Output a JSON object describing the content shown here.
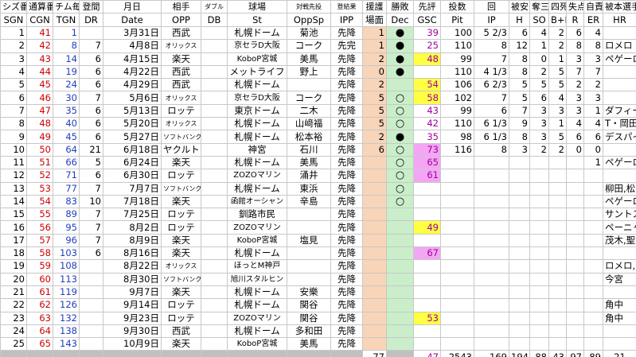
{
  "headers_top": [
    "シズ番",
    "通算番",
    "チム毎",
    "登間",
    "月日",
    "相手",
    "ダブル",
    "球場",
    "対戦先投",
    "登結果",
    "援護",
    "勝敗",
    "先評",
    "投数",
    "回",
    "被安",
    "奪三",
    "四死",
    "失点",
    "自責",
    "被本選手"
  ],
  "headers_bottom": [
    "SGN",
    "CGN",
    "TGN",
    "DR",
    "Date",
    "OPP",
    "DB",
    "St",
    "OppSp",
    "IPP",
    "場面",
    "Dec",
    "GSC",
    "Pit",
    "IP",
    "H",
    "SO",
    "B+H",
    "R",
    "ER",
    "HR"
  ],
  "rows": [
    {
      "sgn": "1",
      "cgn": "41",
      "tgn": "1",
      "dr": "",
      "date": "3月31日",
      "opp": "西武",
      "db": "",
      "st": "札幌ドーム",
      "oppsp": "菊池",
      "ipp": "先降",
      "sup": "1",
      "dec": "●",
      "gsc": "39",
      "pit": "100",
      "ip": "5 2/3",
      "h": "6",
      "so": "4",
      "bh": "2",
      "r": "6",
      "er": "4",
      "hr": ""
    },
    {
      "sgn": "2",
      "cgn": "42",
      "tgn": "8",
      "dr": "7",
      "date": "4月8日",
      "opp": "オリックス",
      "db": "",
      "st": "京セラD大阪",
      "oppsp": "コーク",
      "ipp": "先完",
      "sup": "1",
      "dec": "●",
      "gsc": "25",
      "pit": "110",
      "ip": "8",
      "h": "12",
      "so": "1",
      "bh": "2",
      "r": "8",
      "er": "8",
      "hr": "ロメロ"
    },
    {
      "sgn": "3",
      "cgn": "43",
      "tgn": "14",
      "dr": "6",
      "date": "4月15日",
      "opp": "楽天",
      "db": "",
      "st": "KoboP宮城",
      "oppsp": "美馬",
      "ipp": "先降",
      "sup": "2",
      "dec": "●",
      "gsc": "48",
      "pit": "99",
      "ip": "7",
      "h": "8",
      "so": "0",
      "bh": "1",
      "r": "3",
      "er": "3",
      "hr": "ペゲーロ"
    },
    {
      "sgn": "4",
      "cgn": "44",
      "tgn": "19",
      "dr": "6",
      "date": "4月22日",
      "opp": "西武",
      "db": "",
      "st": "メットライフ",
      "oppsp": "野上",
      "ipp": "先降",
      "sup": "0",
      "dec": "●",
      "gsc": "",
      "pit": "110",
      "ip": "4 1/3",
      "h": "8",
      "so": "2",
      "bh": "5",
      "r": "7",
      "er": "7",
      "hr": ""
    },
    {
      "sgn": "5",
      "cgn": "45",
      "tgn": "24",
      "dr": "6",
      "date": "4月29日",
      "opp": "西武",
      "db": "",
      "st": "札幌ドーム",
      "oppsp": "",
      "ipp": "先降",
      "sup": "2",
      "dec": "",
      "gsc": "54",
      "pit": "106",
      "ip": "6 2/3",
      "h": "5",
      "so": "5",
      "bh": "5",
      "r": "2",
      "er": "2",
      "hr": ""
    },
    {
      "sgn": "6",
      "cgn": "46",
      "tgn": "30",
      "dr": "7",
      "date": "5月6日",
      "opp": "オリックス",
      "db": "",
      "st": "京セラD大阪",
      "oppsp": "コーク",
      "ipp": "先降",
      "sup": "5",
      "dec": "○",
      "gsc": "58",
      "pit": "102",
      "ip": "7",
      "h": "5",
      "so": "6",
      "bh": "4",
      "r": "3",
      "er": "3",
      "hr": ""
    },
    {
      "sgn": "7",
      "cgn": "47",
      "tgn": "35",
      "dr": "6",
      "date": "5月13日",
      "opp": "ロッテ",
      "db": "",
      "st": "東京ドーム",
      "oppsp": "二木",
      "ipp": "先降",
      "sup": "5",
      "dec": "○",
      "gsc": "43",
      "pit": "99",
      "ip": "6",
      "h": "7",
      "so": "3",
      "bh": "3",
      "r": "3",
      "er": "1",
      "hr": "ダフィー,柴田"
    },
    {
      "sgn": "8",
      "cgn": "48",
      "tgn": "40",
      "dr": "6",
      "date": "5月20日",
      "opp": "オリックス",
      "db": "",
      "st": "札幌ドーム",
      "oppsp": "山﨑福",
      "ipp": "先降",
      "sup": "5",
      "dec": "○",
      "gsc": "42",
      "pit": "110",
      "ip": "6 1/3",
      "h": "9",
      "so": "3",
      "bh": "1",
      "r": "4",
      "er": "4",
      "hr": "T・岡田"
    },
    {
      "sgn": "9",
      "cgn": "49",
      "tgn": "45",
      "dr": "6",
      "date": "5月27日",
      "opp": "ソフトバンク",
      "db": "",
      "st": "札幌ドーム",
      "oppsp": "松本裕",
      "ipp": "先降",
      "sup": "2",
      "dec": "●",
      "gsc": "35",
      "pit": "98",
      "ip": "6 1/3",
      "h": "8",
      "so": "3",
      "bh": "5",
      "r": "6",
      "er": "6",
      "hr": "デスパイネ,松田"
    },
    {
      "sgn": "10",
      "cgn": "50",
      "tgn": "64",
      "dr": "21",
      "date": "6月18日",
      "opp": "ヤクルト",
      "db": "",
      "st": "神宮",
      "oppsp": "石川",
      "ipp": "先降",
      "sup": "6",
      "dec": "○",
      "gsc": "73",
      "pit": "116",
      "ip": "8",
      "h": "3",
      "so": "2",
      "bh": "2",
      "r": "0",
      "er": "0",
      "hr": ""
    },
    {
      "sgn": "11",
      "cgn": "51",
      "tgn": "66",
      "dr": "5",
      "date": "6月24日",
      "opp": "楽天",
      "db": "",
      "st": "札幌ドーム",
      "oppsp": "美馬",
      "ipp": "先降",
      "sup": "",
      "dec": "○",
      "gsc": "65",
      "pit": "",
      "ip": "",
      "h": "",
      "so": "",
      "bh": "",
      "r": "",
      "er": "1",
      "hr": "ペゲーロ"
    },
    {
      "sgn": "12",
      "cgn": "52",
      "tgn": "71",
      "dr": "6",
      "date": "6月30日",
      "opp": "ロッテ",
      "db": "",
      "st": "ZOZOマリン",
      "oppsp": "涌井",
      "ipp": "先降",
      "sup": "",
      "dec": "○",
      "gsc": "61",
      "pit": "",
      "ip": "",
      "h": "",
      "so": "",
      "bh": "",
      "r": "",
      "er": "",
      "hr": ""
    },
    {
      "sgn": "13",
      "cgn": "53",
      "tgn": "77",
      "dr": "7",
      "date": "7月7日",
      "opp": "ソフトバンク",
      "db": "",
      "st": "札幌ドーム",
      "oppsp": "東浜",
      "ipp": "先降",
      "sup": "",
      "dec": "○",
      "gsc": "",
      "pit": "",
      "ip": "",
      "h": "",
      "so": "",
      "bh": "",
      "r": "",
      "er": "",
      "hr": "柳田,松田"
    },
    {
      "sgn": "14",
      "cgn": "54",
      "tgn": "83",
      "dr": "10",
      "date": "7月18日",
      "opp": "楽天",
      "db": "",
      "st": "函館オーシャン",
      "oppsp": "辛島",
      "ipp": "先降",
      "sup": "",
      "dec": "○",
      "gsc": "",
      "pit": "",
      "ip": "",
      "h": "",
      "so": "",
      "bh": "",
      "r": "",
      "er": "",
      "hr": "ペゲーロ"
    },
    {
      "sgn": "15",
      "cgn": "55",
      "tgn": "89",
      "dr": "7",
      "date": "7月25日",
      "opp": "ロッテ",
      "db": "",
      "st": "釧路市民",
      "oppsp": "",
      "ipp": "先降",
      "sup": "",
      "dec": "",
      "gsc": "",
      "pit": "",
      "ip": "",
      "h": "",
      "so": "",
      "bh": "",
      "r": "",
      "er": "",
      "hr": "サントス"
    },
    {
      "sgn": "16",
      "cgn": "56",
      "tgn": "95",
      "dr": "7",
      "date": "8月2日",
      "opp": "ロッテ",
      "db": "",
      "st": "ZOZOマリン",
      "oppsp": "",
      "ipp": "先降",
      "sup": "",
      "dec": "",
      "gsc": "49",
      "pit": "",
      "ip": "",
      "h": "",
      "so": "",
      "bh": "",
      "r": "",
      "er": "",
      "hr": "ペーニャ2"
    },
    {
      "sgn": "17",
      "cgn": "57",
      "tgn": "96",
      "dr": "7",
      "date": "8月9日",
      "opp": "楽天",
      "db": "",
      "st": "KoboP宮城",
      "oppsp": "塩見",
      "ipp": "先降",
      "sup": "",
      "dec": "",
      "gsc": "",
      "pit": "",
      "ip": "",
      "h": "",
      "so": "",
      "bh": "",
      "r": "",
      "er": "",
      "hr": "茂木,聖澤"
    },
    {
      "sgn": "18",
      "cgn": "58",
      "tgn": "103",
      "dr": "6",
      "date": "8月16日",
      "opp": "楽天",
      "db": "",
      "st": "札幌ドーム",
      "oppsp": "",
      "ipp": "先降",
      "sup": "",
      "dec": "",
      "gsc": "67",
      "pit": "",
      "ip": "",
      "h": "",
      "so": "",
      "bh": "",
      "r": "",
      "er": "",
      "hr": ""
    },
    {
      "sgn": "19",
      "cgn": "59",
      "tgn": "108",
      "dr": "",
      "date": "8月22日",
      "opp": "オリックス",
      "db": "",
      "st": "ほっとM神戸",
      "oppsp": "",
      "ipp": "先降",
      "sup": "",
      "dec": "",
      "gsc": "",
      "pit": "",
      "ip": "",
      "h": "",
      "so": "",
      "bh": "",
      "r": "",
      "er": "",
      "hr": "ロメロ,中島"
    },
    {
      "sgn": "20",
      "cgn": "60",
      "tgn": "113",
      "dr": "",
      "date": "8月30日",
      "opp": "ソフトバンク",
      "db": "",
      "st": "旭川スタルヒン",
      "oppsp": "",
      "ipp": "先降",
      "sup": "",
      "dec": "",
      "gsc": "",
      "pit": "",
      "ip": "",
      "h": "",
      "so": "",
      "bh": "",
      "r": "",
      "er": "",
      "hr": "今宮"
    },
    {
      "sgn": "21",
      "cgn": "61",
      "tgn": "119",
      "dr": "",
      "date": "9月7日",
      "opp": "楽天",
      "db": "",
      "st": "札幌ドーム",
      "oppsp": "安樂",
      "ipp": "先降",
      "sup": "",
      "dec": "",
      "gsc": "",
      "pit": "",
      "ip": "",
      "h": "",
      "so": "",
      "bh": "",
      "r": "",
      "er": "",
      "hr": ""
    },
    {
      "sgn": "22",
      "cgn": "62",
      "tgn": "126",
      "dr": "",
      "date": "9月14日",
      "opp": "ロッテ",
      "db": "",
      "st": "札幌ドーム",
      "oppsp": "関谷",
      "ipp": "先降",
      "sup": "",
      "dec": "",
      "gsc": "",
      "pit": "",
      "ip": "",
      "h": "",
      "so": "",
      "bh": "",
      "r": "",
      "er": "",
      "hr": "角中"
    },
    {
      "sgn": "23",
      "cgn": "63",
      "tgn": "132",
      "dr": "",
      "date": "9月23日",
      "opp": "ロッテ",
      "db": "",
      "st": "ZOZOマリン",
      "oppsp": "関谷",
      "ipp": "先降",
      "sup": "",
      "dec": "",
      "gsc": "53",
      "pit": "",
      "ip": "",
      "h": "",
      "so": "",
      "bh": "",
      "r": "",
      "er": "",
      "hr": "角中"
    },
    {
      "sgn": "24",
      "cgn": "64",
      "tgn": "138",
      "dr": "",
      "date": "9月30日",
      "opp": "西武",
      "db": "",
      "st": "札幌ドーム",
      "oppsp": "多和田",
      "ipp": "先降",
      "sup": "",
      "dec": "",
      "gsc": "",
      "pit": "",
      "ip": "",
      "h": "",
      "so": "",
      "bh": "",
      "r": "",
      "er": "",
      "hr": ""
    },
    {
      "sgn": "25",
      "cgn": "65",
      "tgn": "143",
      "dr": "",
      "date": "10月9日",
      "opp": "楽天",
      "db": "",
      "st": "KoboP宮城",
      "oppsp": "美馬",
      "ipp": "先降",
      "sup": "",
      "dec": "",
      "gsc": "",
      "pit": "",
      "ip": "",
      "h": "",
      "so": "",
      "bh": "",
      "r": "",
      "er": "",
      "hr": ""
    }
  ],
  "totals": {
    "sup": "77",
    "gsc": "47",
    "pit": "2543",
    "ip": "169",
    "h": "194",
    "so": "88",
    "bh": "43",
    "r": "97",
    "er": "89",
    "hr": "21"
  }
}
